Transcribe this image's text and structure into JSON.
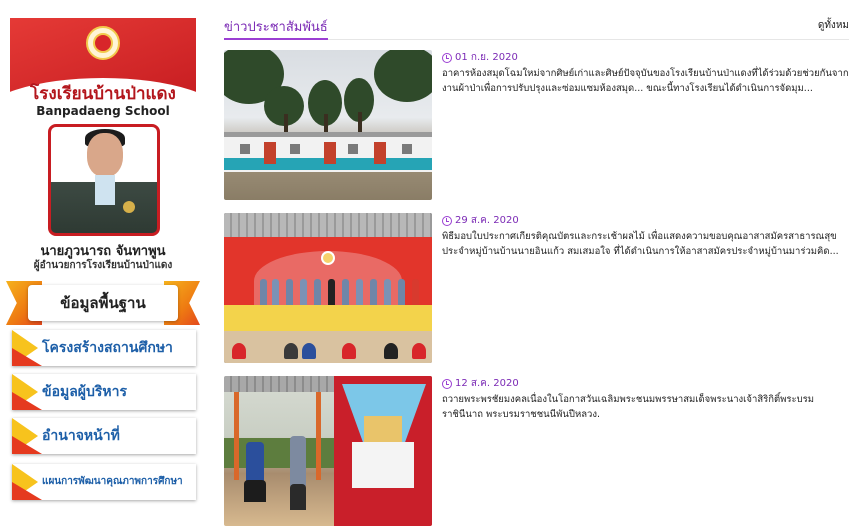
{
  "sidebar": {
    "school_name_th": "โรงเรียนบ้านป่าแดง",
    "school_name_en": "Banpadaeng School",
    "director_name": "นายภูวนารถ   จันทาพูน",
    "director_title": "ผู้อำนวยการโรงเรียนบ้านป่าแดง",
    "basic_info_label": "ข้อมูลพื้นฐาน",
    "menu_items": [
      {
        "label": "โครงสร้างสถานศึกษา"
      },
      {
        "label": "ข้อมูลผู้บริหาร"
      },
      {
        "label": "อำนาจหน้าที่"
      },
      {
        "label": "แผนการพัฒนาคุณภาพการศึกษา"
      }
    ]
  },
  "main": {
    "section_title": "ข่าวประชาสัมพันธ์",
    "view_all_label": "ดูทั้งหม",
    "news": [
      {
        "date": "01 ก.ย. 2020",
        "text": "อาคารห้องสมุดโฉมใหม่จากศิษย์เก่าและศิษย์ปัจจุบันของโรงเรียนบ้านป่าแดงที่ได้ร่วมด้วยช่วยกันจากงานผ้าป่าเพื่อการปรับปรุงและซ่อมแซมห้องสมุด... ขณะนี้ทางโรงเรียนได้ดำเนินการจัดมุม..."
      },
      {
        "date": "29 ส.ค. 2020",
        "text": "พิธีมอบใบประกาศเกียรติคุณบัตรและกระเช้าผลไม้ เพื่อแสดงความขอบคุณอาสาสมัครสาธารณสุขประจำหมู่บ้านบ้านนายอินแก้ว สมเสมอใจ ที่ได้ดำเนินการให้อาสาสมัครประจำหมู่บ้านมาร่วมคิด..."
      },
      {
        "date": "12 ส.ค. 2020",
        "text": "ถวายพระพรชัยมงคลเนื่องในโอกาสวันเฉลิมพระชนมพรรษาสมเด็จพระนางเจ้าสิริกิติ์พระบรมราชินีนาถ พระบรมราชชนนีพันปีหลวง."
      }
    ]
  },
  "colors": {
    "accent_purple": "#7b2ab5",
    "brand_red": "#c81d22",
    "menu_text_blue": "#1d5fa8"
  }
}
